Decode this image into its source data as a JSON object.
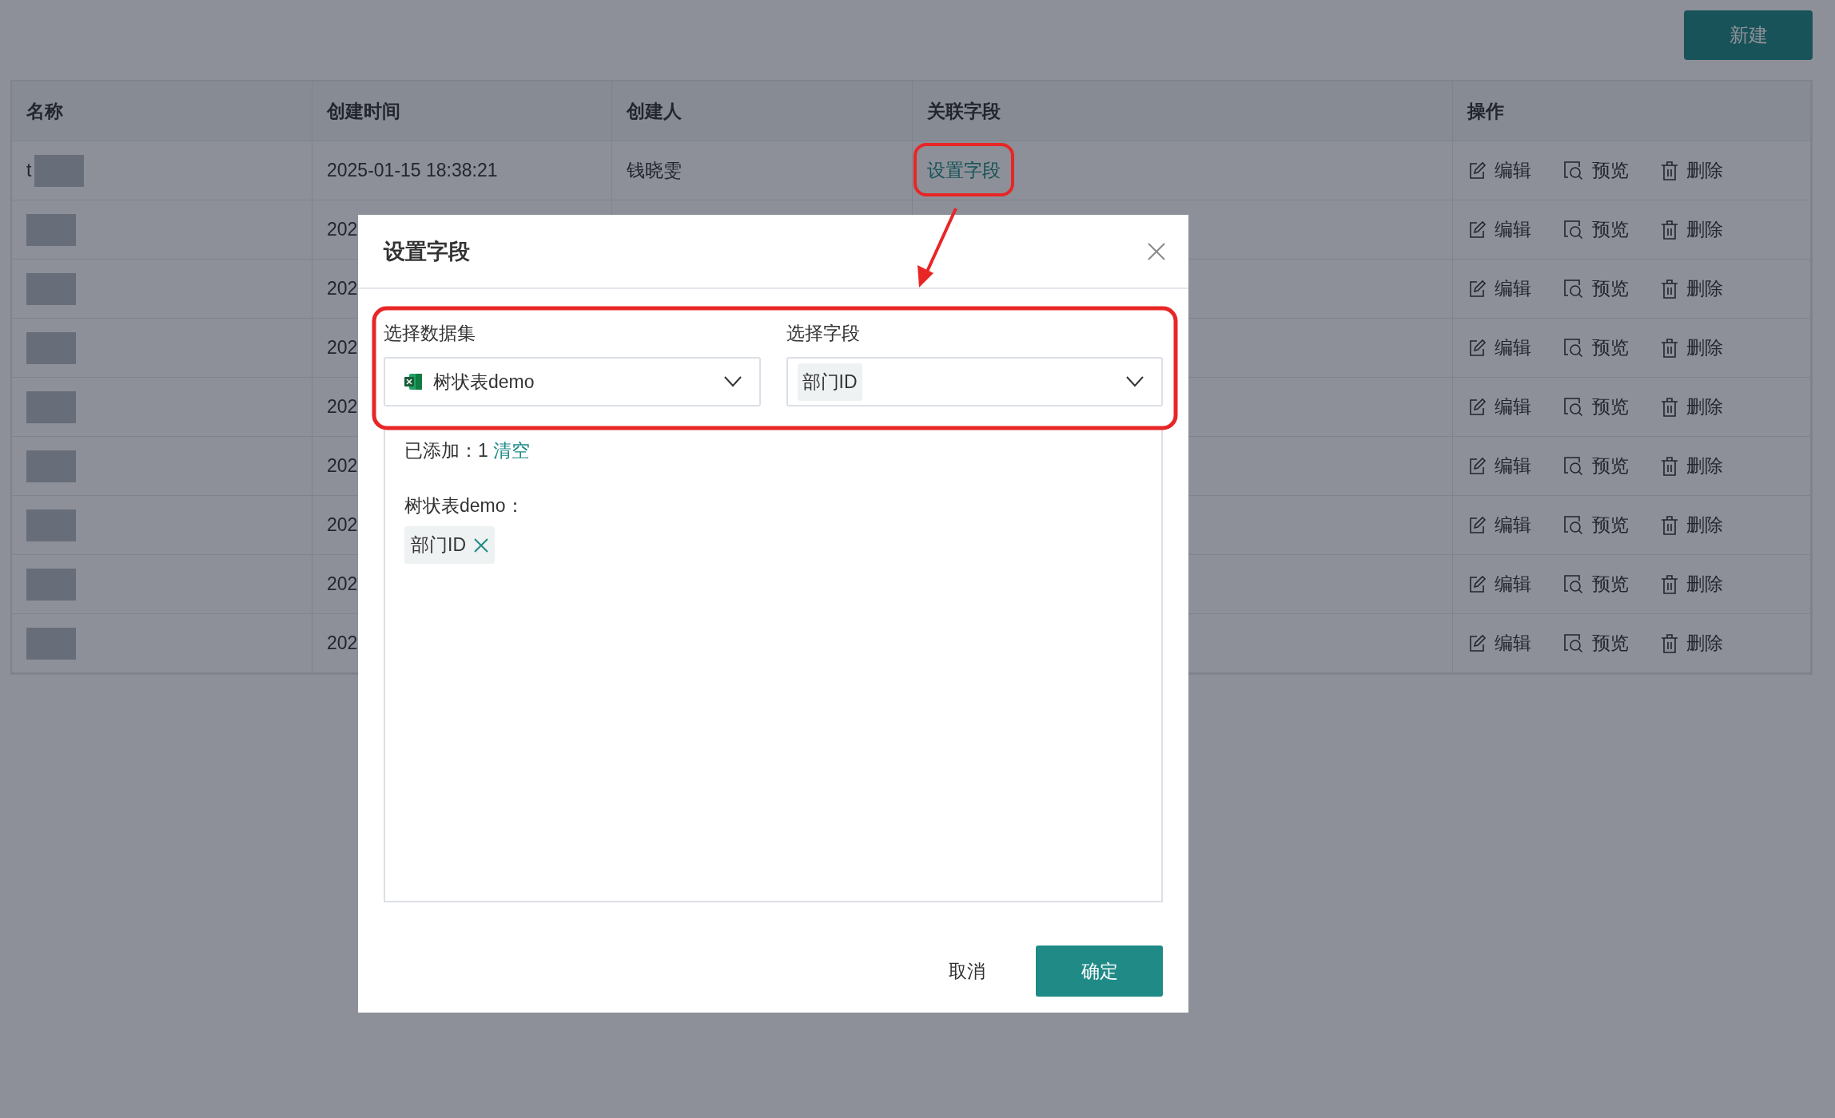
{
  "toolbar": {
    "new_button": "新建"
  },
  "table": {
    "columns": [
      "名称",
      "创建时间",
      "创建人",
      "关联字段",
      "操作"
    ],
    "rows": [
      {
        "name": "t",
        "created": "2025-01-15 18:38:21",
        "creator": "钱晓雯",
        "field_link": "设置字段",
        "actions": [
          {
            "kind": "edit",
            "label": "编辑"
          },
          {
            "kind": "preview",
            "label": "预览"
          },
          {
            "kind": "delete",
            "label": "删除"
          }
        ]
      },
      {
        "created": "202",
        "actions": [
          {
            "kind": "edit",
            "label": "编辑"
          },
          {
            "kind": "preview",
            "label": "预览"
          },
          {
            "kind": "delete",
            "label": "删除"
          }
        ]
      },
      {
        "created": "202",
        "actions": [
          {
            "kind": "edit",
            "label": "编辑"
          },
          {
            "kind": "preview",
            "label": "预览"
          },
          {
            "kind": "delete",
            "label": "删除"
          }
        ]
      },
      {
        "created": "202",
        "actions": [
          {
            "kind": "edit",
            "label": "编辑"
          },
          {
            "kind": "preview",
            "label": "预览"
          },
          {
            "kind": "delete",
            "label": "删除"
          }
        ]
      },
      {
        "created": "202",
        "actions": [
          {
            "kind": "edit",
            "label": "编辑"
          },
          {
            "kind": "preview",
            "label": "预览"
          },
          {
            "kind": "delete",
            "label": "删除"
          }
        ]
      },
      {
        "created": "202",
        "actions": [
          {
            "kind": "edit",
            "label": "编辑"
          },
          {
            "kind": "preview",
            "label": "预览"
          },
          {
            "kind": "delete",
            "label": "删除"
          }
        ]
      },
      {
        "created": "202",
        "actions": [
          {
            "kind": "edit",
            "label": "编辑"
          },
          {
            "kind": "preview",
            "label": "预览"
          },
          {
            "kind": "delete",
            "label": "删除"
          }
        ]
      },
      {
        "created": "202",
        "actions": [
          {
            "kind": "edit",
            "label": "编辑"
          },
          {
            "kind": "preview",
            "label": "预览"
          },
          {
            "kind": "delete",
            "label": "删除"
          }
        ]
      },
      {
        "created": "202",
        "actions": [
          {
            "kind": "edit",
            "label": "编辑"
          },
          {
            "kind": "preview",
            "label": "预览"
          },
          {
            "kind": "delete",
            "label": "删除"
          }
        ]
      }
    ]
  },
  "dialog": {
    "title": "设置字段",
    "fields": [
      {
        "kind": "dataset",
        "label": "选择数据集",
        "value": "树状表demo"
      },
      {
        "kind": "tag",
        "label": "选择字段",
        "value": "部门ID"
      }
    ],
    "added": {
      "label": "已添加：",
      "count": "1",
      "clear": "清空",
      "groups": [
        {
          "name": "树状表demo：",
          "tags": [
            "部门ID"
          ]
        }
      ]
    },
    "buttons": [
      {
        "kind": "secondary",
        "label": "取消"
      },
      {
        "kind": "primary",
        "label": "确定"
      }
    ]
  }
}
